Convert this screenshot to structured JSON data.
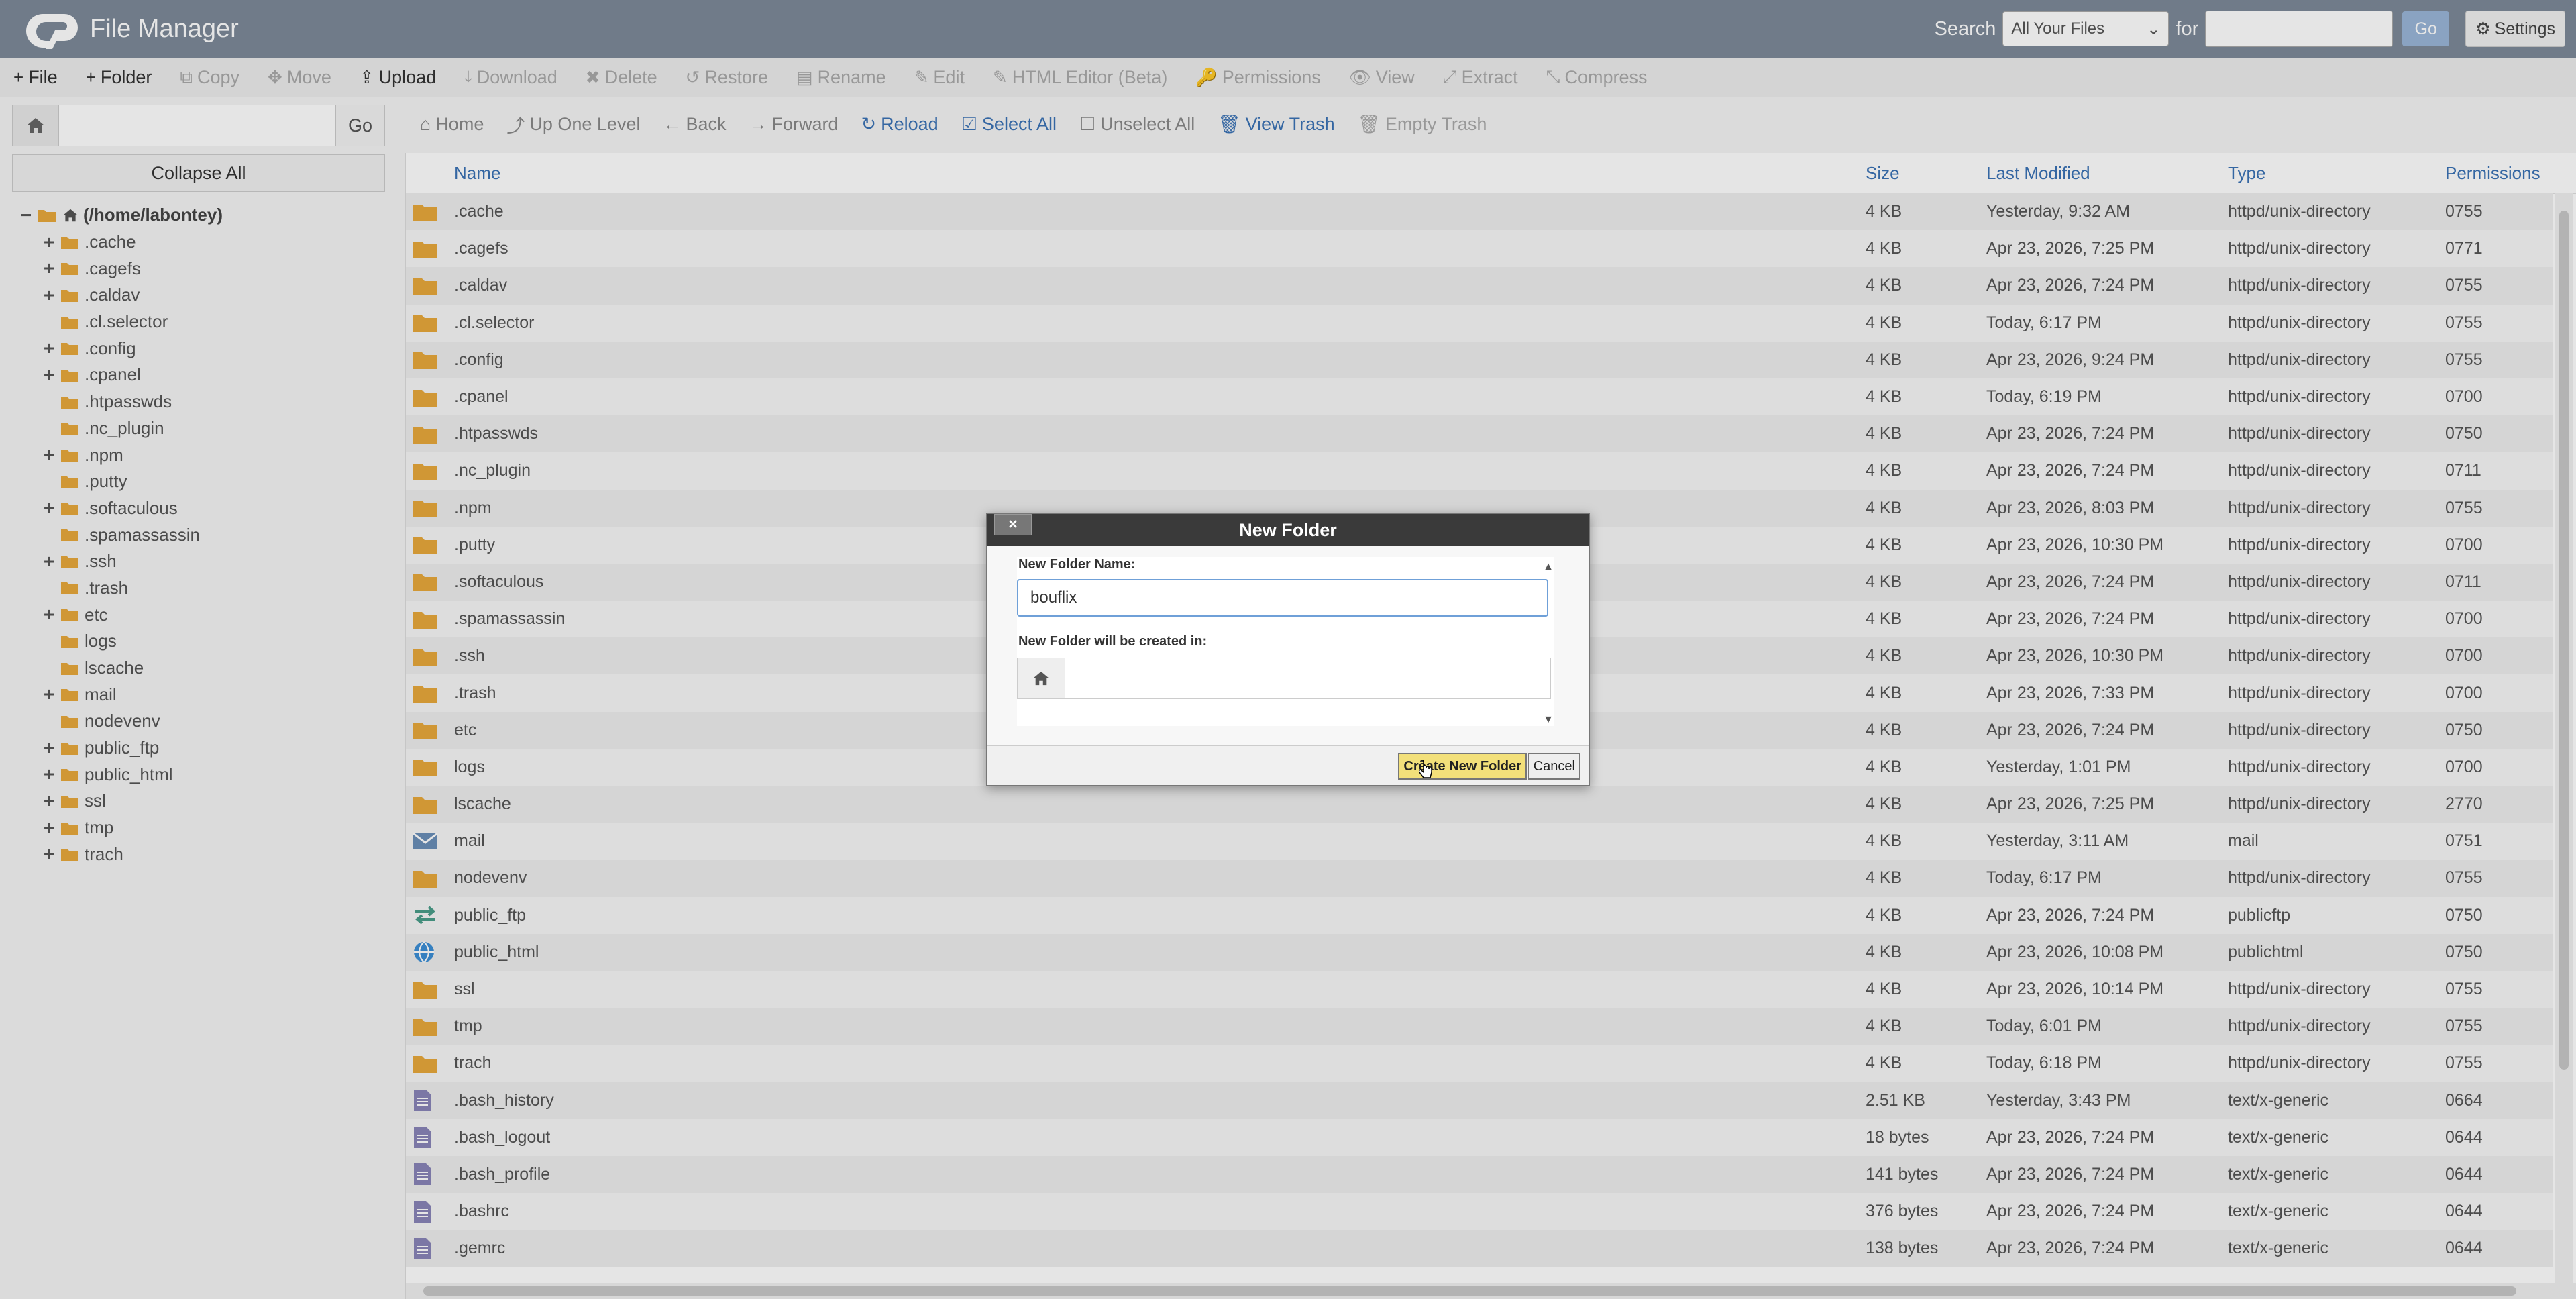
{
  "app": {
    "title": "File Manager"
  },
  "colors": {
    "topbar": "#7d8a99",
    "link_blue": "#3a72b5",
    "folder": "#e8a93c",
    "dialog_header": "#3a3a3a",
    "create_button": "#f3e07a"
  },
  "search": {
    "label": "Search",
    "scope": "All Your Files",
    "for_label": "for",
    "query": "",
    "go": "Go"
  },
  "settings_label": "Settings",
  "toolbar": [
    {
      "label": "File",
      "icon": "+",
      "enabled": true
    },
    {
      "label": "Folder",
      "icon": "+",
      "enabled": true
    },
    {
      "label": "Copy",
      "icon": "⧉",
      "enabled": false
    },
    {
      "label": "Move",
      "icon": "✥",
      "enabled": false
    },
    {
      "label": "Upload",
      "icon": "⇪",
      "enabled": true
    },
    {
      "label": "Download",
      "icon": "⤓",
      "enabled": false
    },
    {
      "label": "Delete",
      "icon": "✖",
      "enabled": false
    },
    {
      "label": "Restore",
      "icon": "↺",
      "enabled": false
    },
    {
      "label": "Rename",
      "icon": "▤",
      "enabled": false
    },
    {
      "label": "Edit",
      "icon": "✎",
      "enabled": false
    },
    {
      "label": "HTML Editor (Beta)",
      "icon": "✎",
      "enabled": false
    },
    {
      "label": "Permissions",
      "icon": "🔑",
      "enabled": false
    },
    {
      "label": "View",
      "icon": "👁",
      "enabled": false
    },
    {
      "label": "Extract",
      "icon": "⤢",
      "enabled": false
    },
    {
      "label": "Compress",
      "icon": "⤡",
      "enabled": false
    }
  ],
  "sidebar": {
    "path_value": "",
    "go": "Go",
    "collapse_all": "Collapse All"
  },
  "tree": [
    {
      "label": "(/home/labontey)",
      "toggle": "−",
      "root": true
    },
    {
      "label": ".cache",
      "toggle": "+"
    },
    {
      "label": ".cagefs",
      "toggle": "+"
    },
    {
      "label": ".caldav",
      "toggle": "+"
    },
    {
      "label": ".cl.selector",
      "toggle": ""
    },
    {
      "label": ".config",
      "toggle": "+"
    },
    {
      "label": ".cpanel",
      "toggle": "+"
    },
    {
      "label": ".htpasswds",
      "toggle": ""
    },
    {
      "label": ".nc_plugin",
      "toggle": ""
    },
    {
      "label": ".npm",
      "toggle": "+"
    },
    {
      "label": ".putty",
      "toggle": ""
    },
    {
      "label": ".softaculous",
      "toggle": "+"
    },
    {
      "label": ".spamassassin",
      "toggle": ""
    },
    {
      "label": ".ssh",
      "toggle": "+"
    },
    {
      "label": ".trash",
      "toggle": ""
    },
    {
      "label": "etc",
      "toggle": "+"
    },
    {
      "label": "logs",
      "toggle": ""
    },
    {
      "label": "lscache",
      "toggle": ""
    },
    {
      "label": "mail",
      "toggle": "+"
    },
    {
      "label": "nodevenv",
      "toggle": ""
    },
    {
      "label": "public_ftp",
      "toggle": "+"
    },
    {
      "label": "public_html",
      "toggle": "+"
    },
    {
      "label": "ssl",
      "toggle": "+"
    },
    {
      "label": "tmp",
      "toggle": "+"
    },
    {
      "label": "trach",
      "toggle": "+"
    }
  ],
  "actions": [
    {
      "label": "Home",
      "icon": "⌂",
      "style": "gray"
    },
    {
      "label": "Up One Level",
      "icon": "⤴",
      "style": "gray"
    },
    {
      "label": "Back",
      "icon": "←",
      "style": "gray"
    },
    {
      "label": "Forward",
      "icon": "→",
      "style": "gray"
    },
    {
      "label": "Reload",
      "icon": "↻",
      "style": "blue"
    },
    {
      "label": "Select All",
      "icon": "☑",
      "style": "blue"
    },
    {
      "label": "Unselect All",
      "icon": "☐",
      "style": "gray"
    },
    {
      "label": "View Trash",
      "icon": "🗑",
      "style": "blue"
    },
    {
      "label": "Empty Trash",
      "icon": "🗑",
      "style": "dim"
    }
  ],
  "table": {
    "headers": {
      "name": "Name",
      "size": "Size",
      "modified": "Last Modified",
      "type": "Type",
      "perms": "Permissions"
    },
    "rows": [
      {
        "icon": "folder",
        "name": ".cache",
        "size": "4 KB",
        "modified": "Yesterday, 9:32 AM",
        "type": "httpd/unix-directory",
        "perms": "0755"
      },
      {
        "icon": "folder",
        "name": ".cagefs",
        "size": "4 KB",
        "modified": "Apr 23, 2026, 7:25 PM",
        "type": "httpd/unix-directory",
        "perms": "0771"
      },
      {
        "icon": "folder",
        "name": ".caldav",
        "size": "4 KB",
        "modified": "Apr 23, 2026, 7:24 PM",
        "type": "httpd/unix-directory",
        "perms": "0755"
      },
      {
        "icon": "folder",
        "name": ".cl.selector",
        "size": "4 KB",
        "modified": "Today, 6:17 PM",
        "type": "httpd/unix-directory",
        "perms": "0755"
      },
      {
        "icon": "folder",
        "name": ".config",
        "size": "4 KB",
        "modified": "Apr 23, 2026, 9:24 PM",
        "type": "httpd/unix-directory",
        "perms": "0755"
      },
      {
        "icon": "folder",
        "name": ".cpanel",
        "size": "4 KB",
        "modified": "Today, 6:19 PM",
        "type": "httpd/unix-directory",
        "perms": "0700"
      },
      {
        "icon": "folder",
        "name": ".htpasswds",
        "size": "4 KB",
        "modified": "Apr 23, 2026, 7:24 PM",
        "type": "httpd/unix-directory",
        "perms": "0750"
      },
      {
        "icon": "folder",
        "name": ".nc_plugin",
        "size": "4 KB",
        "modified": "Apr 23, 2026, 7:24 PM",
        "type": "httpd/unix-directory",
        "perms": "0711"
      },
      {
        "icon": "folder",
        "name": ".npm",
        "size": "4 KB",
        "modified": "Apr 23, 2026, 8:03 PM",
        "type": "httpd/unix-directory",
        "perms": "0755"
      },
      {
        "icon": "folder",
        "name": ".putty",
        "size": "4 KB",
        "modified": "Apr 23, 2026, 10:30 PM",
        "type": "httpd/unix-directory",
        "perms": "0700"
      },
      {
        "icon": "folder",
        "name": ".softaculous",
        "size": "4 KB",
        "modified": "Apr 23, 2026, 7:24 PM",
        "type": "httpd/unix-directory",
        "perms": "0711"
      },
      {
        "icon": "folder",
        "name": ".spamassassin",
        "size": "4 KB",
        "modified": "Apr 23, 2026, 7:24 PM",
        "type": "httpd/unix-directory",
        "perms": "0700"
      },
      {
        "icon": "folder",
        "name": ".ssh",
        "size": "4 KB",
        "modified": "Apr 23, 2026, 10:30 PM",
        "type": "httpd/unix-directory",
        "perms": "0700"
      },
      {
        "icon": "folder",
        "name": ".trash",
        "size": "4 KB",
        "modified": "Apr 23, 2026, 7:33 PM",
        "type": "httpd/unix-directory",
        "perms": "0700"
      },
      {
        "icon": "folder",
        "name": "etc",
        "size": "4 KB",
        "modified": "Apr 23, 2026, 7:24 PM",
        "type": "httpd/unix-directory",
        "perms": "0750"
      },
      {
        "icon": "folder",
        "name": "logs",
        "size": "4 KB",
        "modified": "Yesterday, 1:01 PM",
        "type": "httpd/unix-directory",
        "perms": "0700"
      },
      {
        "icon": "folder",
        "name": "lscache",
        "size": "4 KB",
        "modified": "Apr 23, 2026, 7:25 PM",
        "type": "httpd/unix-directory",
        "perms": "2770"
      },
      {
        "icon": "mail",
        "name": "mail",
        "size": "4 KB",
        "modified": "Yesterday, 3:11 AM",
        "type": "mail",
        "perms": "0751"
      },
      {
        "icon": "folder",
        "name": "nodevenv",
        "size": "4 KB",
        "modified": "Today, 6:17 PM",
        "type": "httpd/unix-directory",
        "perms": "0755"
      },
      {
        "icon": "ftp",
        "name": "public_ftp",
        "size": "4 KB",
        "modified": "Apr 23, 2026, 7:24 PM",
        "type": "publicftp",
        "perms": "0750"
      },
      {
        "icon": "globe",
        "name": "public_html",
        "size": "4 KB",
        "modified": "Apr 23, 2026, 10:08 PM",
        "type": "publichtml",
        "perms": "0750"
      },
      {
        "icon": "folder",
        "name": "ssl",
        "size": "4 KB",
        "modified": "Apr 23, 2026, 10:14 PM",
        "type": "httpd/unix-directory",
        "perms": "0755"
      },
      {
        "icon": "folder",
        "name": "tmp",
        "size": "4 KB",
        "modified": "Today, 6:01 PM",
        "type": "httpd/unix-directory",
        "perms": "0755"
      },
      {
        "icon": "folder",
        "name": "trach",
        "size": "4 KB",
        "modified": "Today, 6:18 PM",
        "type": "httpd/unix-directory",
        "perms": "0755"
      },
      {
        "icon": "file",
        "name": ".bash_history",
        "size": "2.51 KB",
        "modified": "Yesterday, 3:43 PM",
        "type": "text/x-generic",
        "perms": "0664"
      },
      {
        "icon": "file",
        "name": ".bash_logout",
        "size": "18 bytes",
        "modified": "Apr 23, 2026, 7:24 PM",
        "type": "text/x-generic",
        "perms": "0644"
      },
      {
        "icon": "file",
        "name": ".bash_profile",
        "size": "141 bytes",
        "modified": "Apr 23, 2026, 7:24 PM",
        "type": "text/x-generic",
        "perms": "0644"
      },
      {
        "icon": "file",
        "name": ".bashrc",
        "size": "376 bytes",
        "modified": "Apr 23, 2026, 7:24 PM",
        "type": "text/x-generic",
        "perms": "0644"
      },
      {
        "icon": "file",
        "name": ".gemrc",
        "size": "138 bytes",
        "modified": "Apr 23, 2026, 7:24 PM",
        "type": "text/x-generic",
        "perms": "0644"
      }
    ]
  },
  "dialog": {
    "title": "New Folder",
    "close": "×",
    "name_label": "New Folder Name:",
    "name_value": "bouflix",
    "location_label": "New Folder will be created in:",
    "location_value": "",
    "create_button": "Create New Folder",
    "cancel_button": "Cancel"
  }
}
